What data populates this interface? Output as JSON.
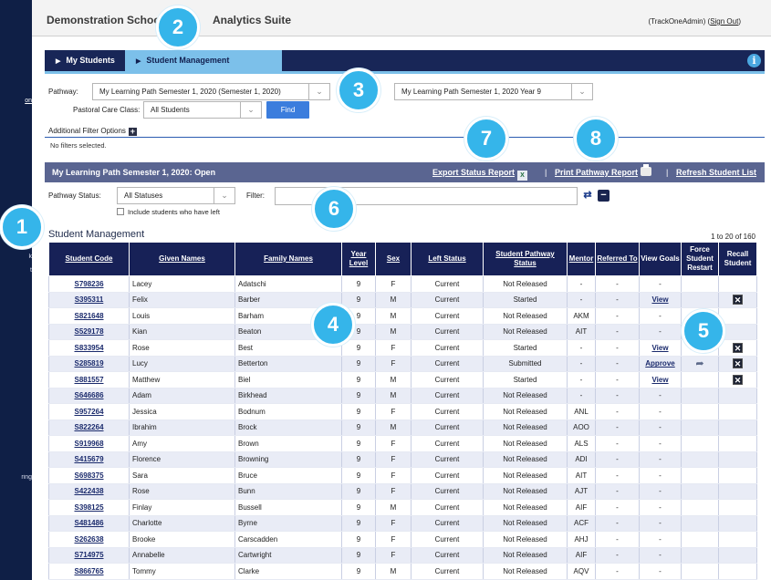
{
  "app": {
    "title": "Demonstration School",
    "title_suffix": "Analytics Suite",
    "user": "(TrackOneAdmin)",
    "sign_out": "Sign Out"
  },
  "sidebar": {
    "fragments": [
      "on",
      "k",
      "t",
      "ring"
    ]
  },
  "tabs": [
    {
      "label": "My Students",
      "active": false
    },
    {
      "label": "Student Management",
      "active": true
    }
  ],
  "filters": {
    "pathway_label": "Pathway:",
    "pathway_value": "My Learning Path Semester 1, 2020 (Semester 1, 2020)",
    "pathway_year_value": "My Learning Path Semester 1, 2020 Year 9",
    "pastoral_label": "Pastoral Care Class:",
    "pastoral_value": "All Students",
    "find_label": "Find",
    "additional_label": "Additional Filter Options",
    "no_filters": "No filters selected."
  },
  "section": {
    "title": "My Learning Path Semester 1, 2020:  Open",
    "export": "Export Status Report",
    "print": "Print Pathway Report",
    "refresh": "Refresh Student List",
    "separator": "|"
  },
  "status_filter": {
    "status_label": "Pathway Status:",
    "status_value": "All Statuses",
    "filter_label": "Filter:",
    "include_left": "Include students who have left"
  },
  "table": {
    "title": "Student Management",
    "page_info": "1 to 20 of 160",
    "headers": [
      "Student Code",
      "Given Names",
      "Family Names",
      "Year Level",
      "Sex",
      "Left Status",
      "Student Pathway Status",
      "Mentor",
      "Referred To",
      "View Goals",
      "Force Student Restart",
      "Recall Student"
    ],
    "rows": [
      {
        "code": "S798236",
        "given": "Lacey",
        "family": "Adatschi",
        "year": "9",
        "sex": "F",
        "left": "Current",
        "status": "Not Released",
        "mentor": "-",
        "referred": "-",
        "view": "-",
        "restart": "",
        "recall": ""
      },
      {
        "code": "S395311",
        "given": "Felix",
        "family": "Barber",
        "year": "9",
        "sex": "M",
        "left": "Current",
        "status": "Started",
        "mentor": "-",
        "referred": "-",
        "view": "View",
        "restart": "",
        "recall": "x"
      },
      {
        "code": "S821648",
        "given": "Louis",
        "family": "Barham",
        "year": "9",
        "sex": "M",
        "left": "Current",
        "status": "Not Released",
        "mentor": "AKM",
        "referred": "-",
        "view": "-",
        "restart": "",
        "recall": ""
      },
      {
        "code": "S529178",
        "given": "Kian",
        "family": "Beaton",
        "year": "9",
        "sex": "M",
        "left": "Current",
        "status": "Not Released",
        "mentor": "AIT",
        "referred": "-",
        "view": "-",
        "restart": "",
        "recall": ""
      },
      {
        "code": "S833954",
        "given": "Rose",
        "family": "Best",
        "year": "9",
        "sex": "F",
        "left": "Current",
        "status": "Started",
        "mentor": "-",
        "referred": "-",
        "view": "View",
        "restart": "",
        "recall": "x"
      },
      {
        "code": "S285819",
        "given": "Lucy",
        "family": "Betterton",
        "year": "9",
        "sex": "F",
        "left": "Current",
        "status": "Submitted",
        "mentor": "-",
        "referred": "-",
        "view": "Approve",
        "restart": "fwd",
        "recall": "x"
      },
      {
        "code": "S881557",
        "given": "Matthew",
        "family": "Biel",
        "year": "9",
        "sex": "M",
        "left": "Current",
        "status": "Started",
        "mentor": "-",
        "referred": "-",
        "view": "View",
        "restart": "",
        "recall": "x"
      },
      {
        "code": "S646686",
        "given": "Adam",
        "family": "Birkhead",
        "year": "9",
        "sex": "M",
        "left": "Current",
        "status": "Not Released",
        "mentor": "-",
        "referred": "-",
        "view": "-",
        "restart": "",
        "recall": ""
      },
      {
        "code": "S957264",
        "given": "Jessica",
        "family": "Bodnum",
        "year": "9",
        "sex": "F",
        "left": "Current",
        "status": "Not Released",
        "mentor": "ANL",
        "referred": "-",
        "view": "-",
        "restart": "",
        "recall": ""
      },
      {
        "code": "S822264",
        "given": "Ibrahim",
        "family": "Brock",
        "year": "9",
        "sex": "M",
        "left": "Current",
        "status": "Not Released",
        "mentor": "AOO",
        "referred": "-",
        "view": "-",
        "restart": "",
        "recall": ""
      },
      {
        "code": "S919968",
        "given": "Amy",
        "family": "Brown",
        "year": "9",
        "sex": "F",
        "left": "Current",
        "status": "Not Released",
        "mentor": "ALS",
        "referred": "-",
        "view": "-",
        "restart": "",
        "recall": ""
      },
      {
        "code": "S415679",
        "given": "Florence",
        "family": "Browning",
        "year": "9",
        "sex": "F",
        "left": "Current",
        "status": "Not Released",
        "mentor": "ADI",
        "referred": "-",
        "view": "-",
        "restart": "",
        "recall": ""
      },
      {
        "code": "S698375",
        "given": "Sara",
        "family": "Bruce",
        "year": "9",
        "sex": "F",
        "left": "Current",
        "status": "Not Released",
        "mentor": "AIT",
        "referred": "-",
        "view": "-",
        "restart": "",
        "recall": ""
      },
      {
        "code": "S422438",
        "given": "Rose",
        "family": "Bunn",
        "year": "9",
        "sex": "F",
        "left": "Current",
        "status": "Not Released",
        "mentor": "AJT",
        "referred": "-",
        "view": "-",
        "restart": "",
        "recall": ""
      },
      {
        "code": "S398125",
        "given": "Finlay",
        "family": "Bussell",
        "year": "9",
        "sex": "M",
        "left": "Current",
        "status": "Not Released",
        "mentor": "AIF",
        "referred": "-",
        "view": "-",
        "restart": "",
        "recall": ""
      },
      {
        "code": "S481486",
        "given": "Charlotte",
        "family": "Byrne",
        "year": "9",
        "sex": "F",
        "left": "Current",
        "status": "Not Released",
        "mentor": "ACF",
        "referred": "-",
        "view": "-",
        "restart": "",
        "recall": ""
      },
      {
        "code": "S262638",
        "given": "Brooke",
        "family": "Carscadden",
        "year": "9",
        "sex": "F",
        "left": "Current",
        "status": "Not Released",
        "mentor": "AHJ",
        "referred": "-",
        "view": "-",
        "restart": "",
        "recall": ""
      },
      {
        "code": "S714975",
        "given": "Annabelle",
        "family": "Cartwright",
        "year": "9",
        "sex": "F",
        "left": "Current",
        "status": "Not Released",
        "mentor": "AIF",
        "referred": "-",
        "view": "-",
        "restart": "",
        "recall": ""
      },
      {
        "code": "S866765",
        "given": "Tommy",
        "family": "Clarke",
        "year": "9",
        "sex": "M",
        "left": "Current",
        "status": "Not Released",
        "mentor": "AQV",
        "referred": "-",
        "view": "-",
        "restart": "",
        "recall": ""
      }
    ]
  },
  "callouts": [
    "1",
    "2",
    "3",
    "4",
    "5",
    "6",
    "7",
    "8"
  ],
  "icons": {
    "dropdown": "chevron-down-icon",
    "info": "info-icon",
    "plus": "plus-icon",
    "excel": "excel-icon",
    "print": "print-icon",
    "refresh": "refresh-icon",
    "clear": "minus-icon",
    "forward": "forward-arrow-icon",
    "recall": "close-icon"
  },
  "colors": {
    "navy": "#182657",
    "active_tab": "#7cc0ea",
    "section_bar": "#5a6591",
    "find_button": "#3b7ddd",
    "callout": "#35b5ea"
  }
}
